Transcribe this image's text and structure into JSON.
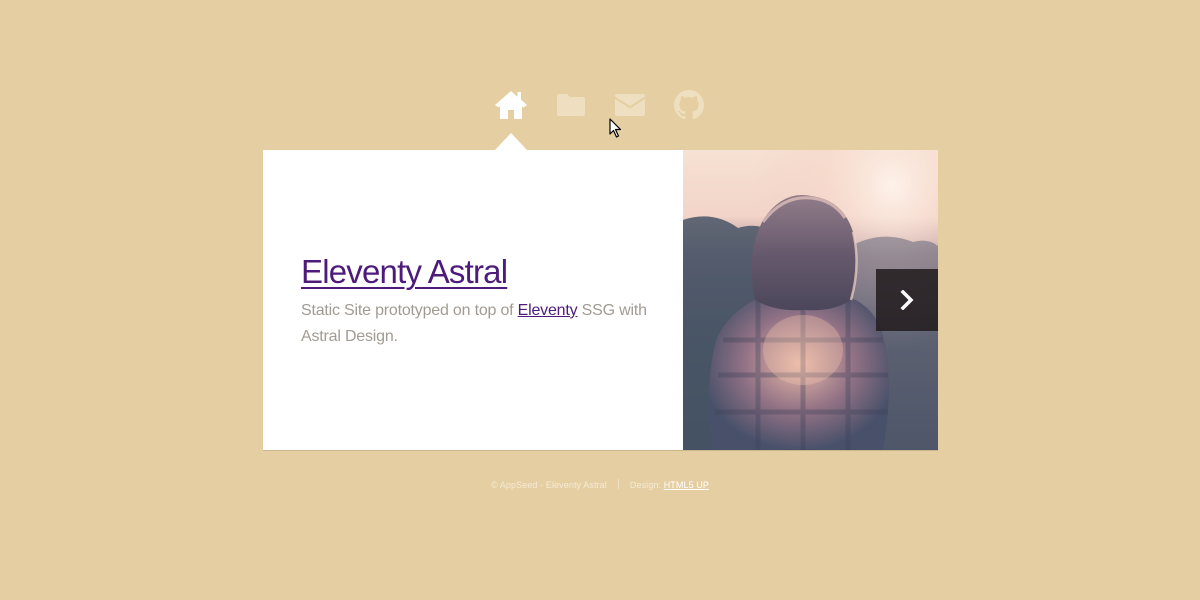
{
  "nav": {
    "items": [
      {
        "name": "home",
        "icon": "home-icon",
        "active": true
      },
      {
        "name": "work",
        "icon": "folder-icon",
        "active": false
      },
      {
        "name": "contact",
        "icon": "envelope-icon",
        "active": false
      },
      {
        "name": "github",
        "icon": "github-icon",
        "active": false
      }
    ]
  },
  "main": {
    "title": "Eleventy Astral",
    "description": {
      "before": "Static Site prototyped on top of ",
      "link": "Eleventy",
      "after": " SSG with Astral Design."
    },
    "next_icon": "chevron-right-icon"
  },
  "footer": {
    "copyright": "© AppSeed - Eleventy Astral",
    "design_label": "Design: ",
    "design_link": "HTML5 UP"
  },
  "colors": {
    "background": "#e5cfa2",
    "panel": "#ffffff",
    "link": "#4e1b7a",
    "text_muted": "#a29b93",
    "nav_inactive": "#eedfc0"
  }
}
